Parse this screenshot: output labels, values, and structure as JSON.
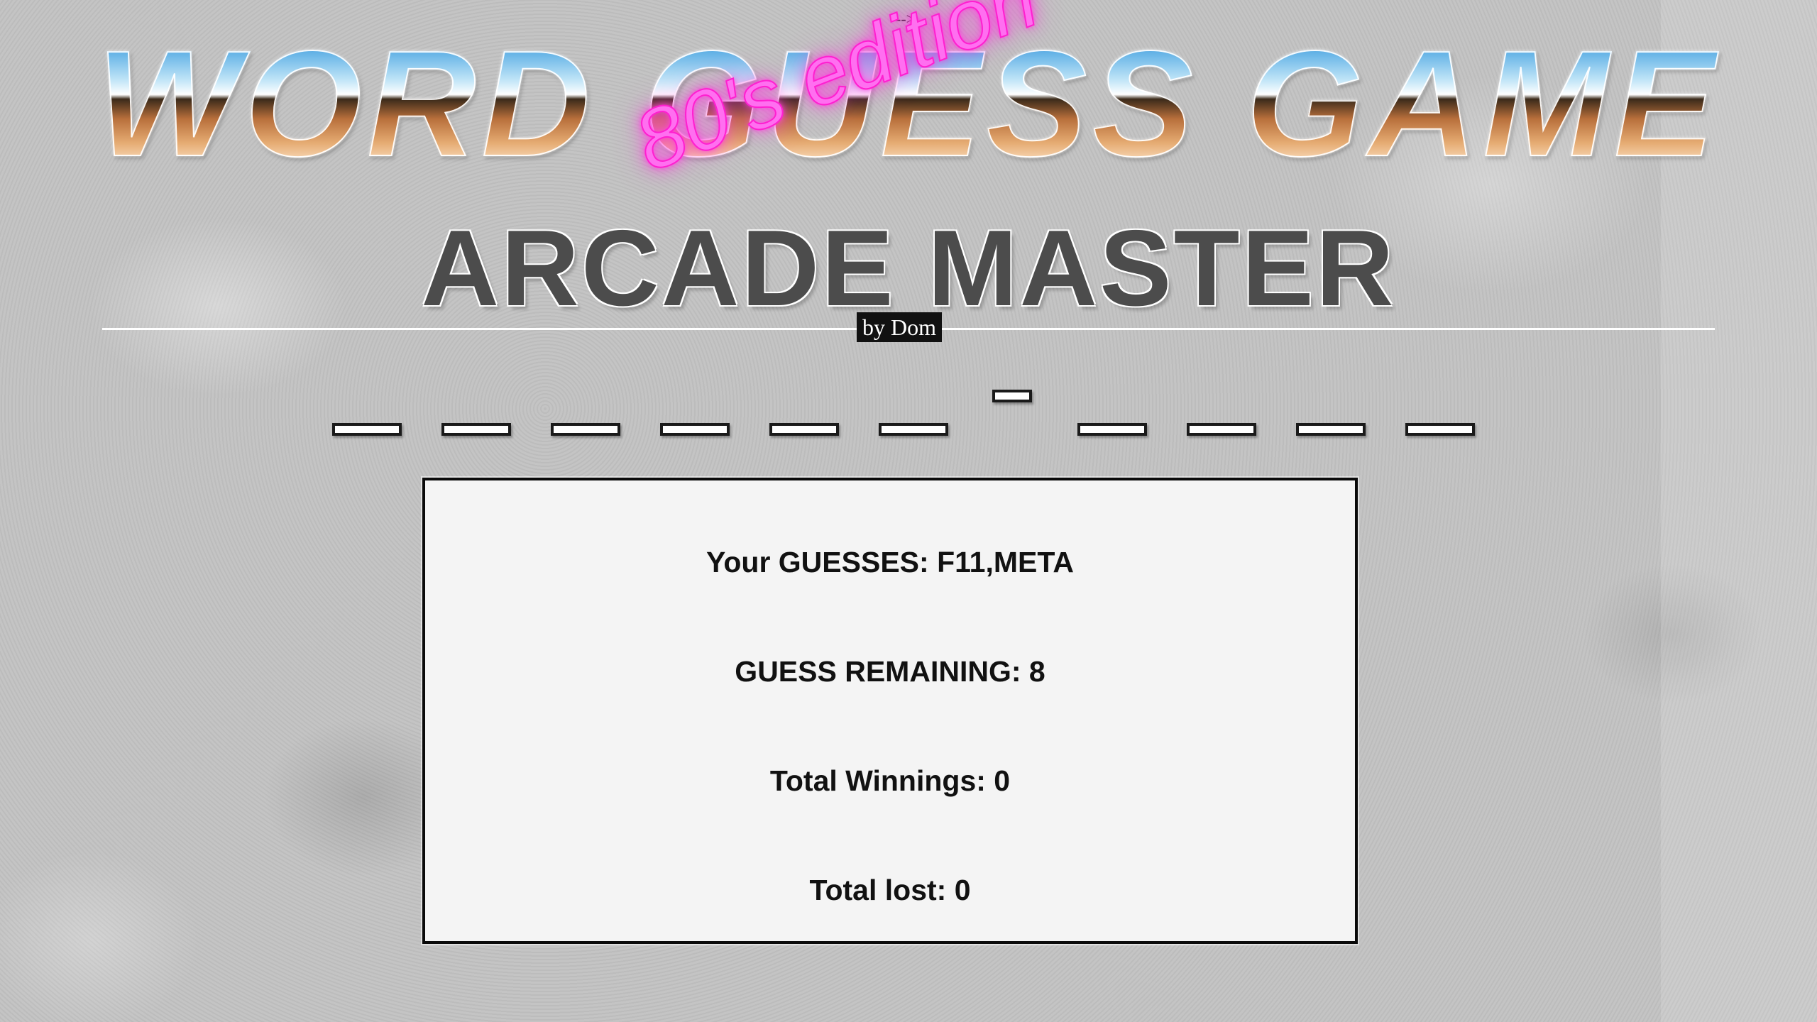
{
  "artifact_text": "-->",
  "title": {
    "main": "WORD GUESS GAME",
    "edition": "80's edition",
    "sub": "ARCADE MASTER",
    "byline": "by Dom"
  },
  "word": {
    "slots_total": 11,
    "revealed_letters": ""
  },
  "stats": {
    "guesses_label": "Your GUESSES: F11,META",
    "remaining_label": "GUESS REMAINING: 8",
    "wins_label": "Total Winnings: 0",
    "losses_label": "Total lost: 0"
  },
  "colors": {
    "neon_pink": "#ff3fe0",
    "chrome_blue": "#63b2e6",
    "chrome_bronze": "#b86f3b",
    "subtitle_gray": "#4c4c4c"
  }
}
